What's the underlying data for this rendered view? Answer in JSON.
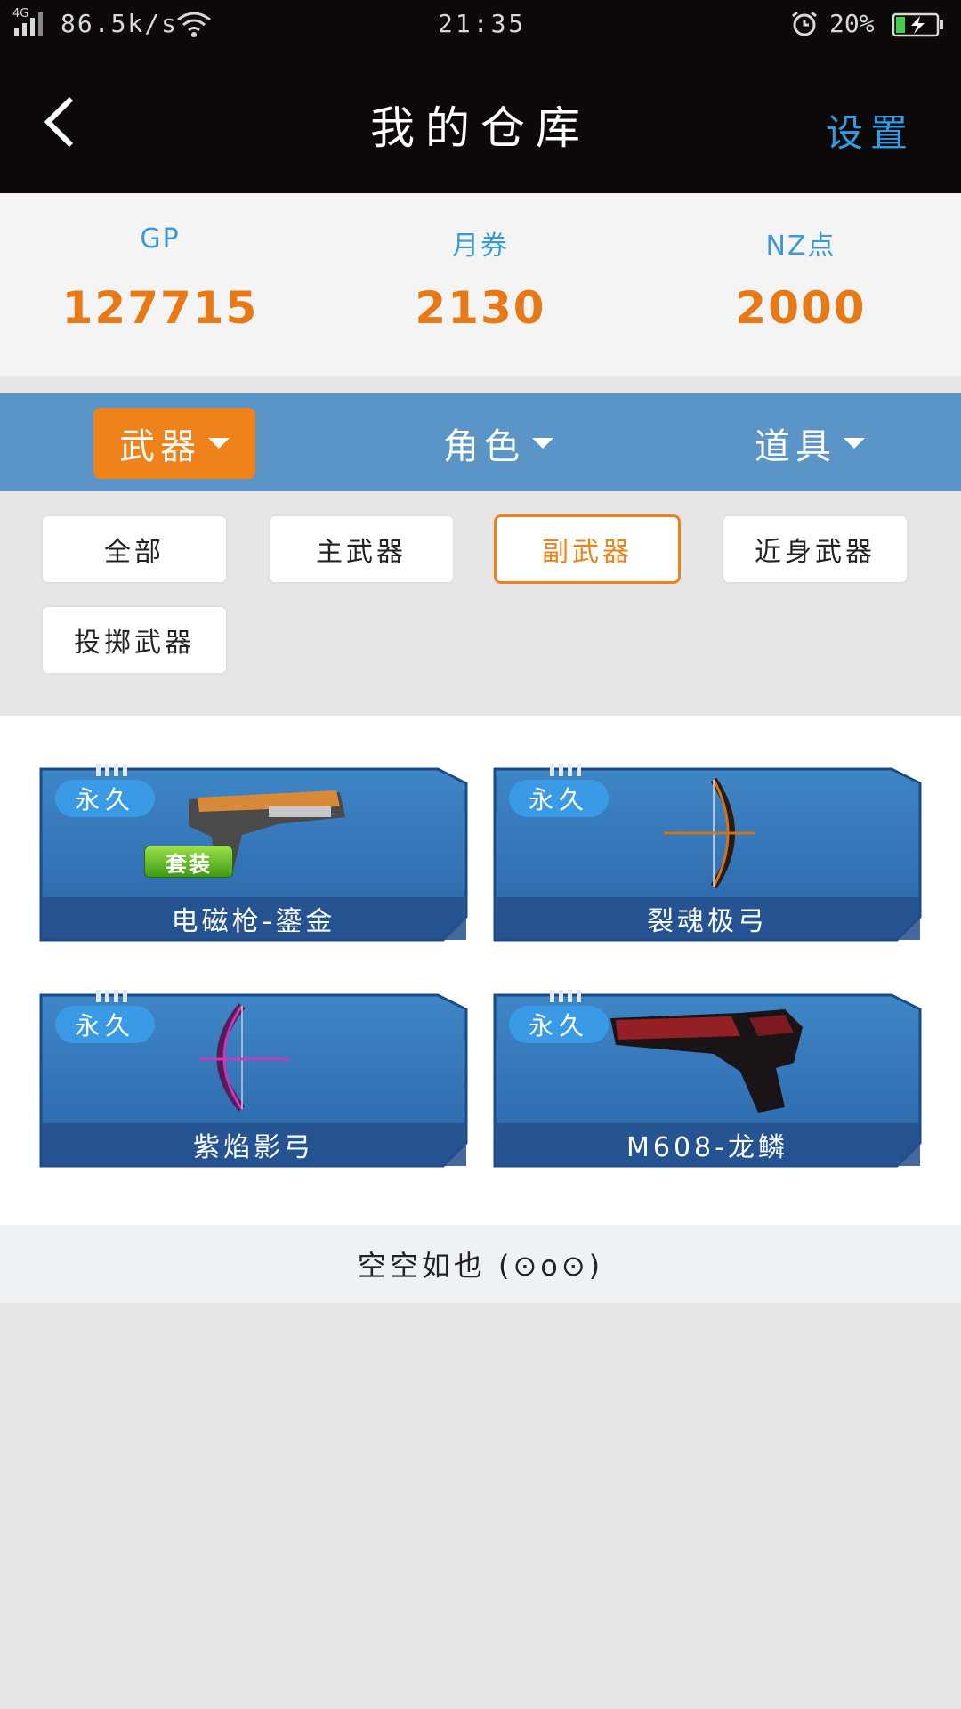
{
  "status_bar": {
    "network": "4G",
    "speed": "86.5k/s",
    "time": "21:35",
    "battery": "20%",
    "icons": [
      "signal-icon",
      "wifi-icon",
      "alarm-icon",
      "battery-charging-icon"
    ]
  },
  "header": {
    "title": "我的仓库",
    "settings_label": "设置",
    "back_icon": "chevron-left-icon"
  },
  "currency": [
    {
      "label": "GP",
      "value": "127715"
    },
    {
      "label": "月券",
      "value": "2130"
    },
    {
      "label": "NZ点",
      "value": "2000"
    }
  ],
  "categories": [
    {
      "label": "武器",
      "active": true
    },
    {
      "label": "角色",
      "active": false
    },
    {
      "label": "道具",
      "active": false
    }
  ],
  "filters": [
    {
      "label": "全部",
      "selected": false
    },
    {
      "label": "主武器",
      "selected": false
    },
    {
      "label": "副武器",
      "selected": true
    },
    {
      "label": "近身武器",
      "selected": false
    },
    {
      "label": "投掷武器",
      "selected": false
    }
  ],
  "items": [
    {
      "badge": "永久",
      "name": "电磁枪-鎏金",
      "set_tag": "套装",
      "icon": "pistol-gold-icon"
    },
    {
      "badge": "永久",
      "name": "裂魂极弓",
      "icon": "bow-icon"
    },
    {
      "badge": "永久",
      "name": "紫焰影弓",
      "icon": "purple-bow-icon"
    },
    {
      "badge": "永久",
      "name": "M608-龙鳞",
      "icon": "dragon-revolver-icon"
    }
  ],
  "empty_text": "空空如也 (⊙o⊙)",
  "colors": {
    "accent_orange": "#ef821a",
    "value_orange": "#e77a16",
    "link_blue": "#2f9ce8",
    "category_bar": "#5b95c8",
    "header_bg": "#0d0908"
  }
}
